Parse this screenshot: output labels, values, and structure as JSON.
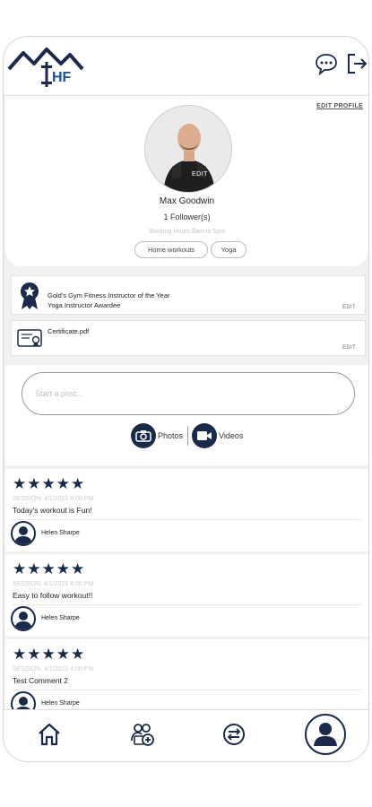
{
  "header": {
    "logo_text": "HF",
    "icons": [
      "chat-bubble-icon",
      "logout-icon"
    ]
  },
  "profile": {
    "edit_label": "EDIT PROFILE",
    "avatar_edit_label": "EDIT",
    "name": "Max Goodwin",
    "followers": "1 Follower(s)",
    "working_hours": "Working Hours 8am to 5pm",
    "tags": [
      "Home workouts",
      "Yoga"
    ]
  },
  "credentials": [
    {
      "lines": [
        "Gold's Gym Fitness Instructor of the Year",
        "Yoga Instructor Awardee"
      ],
      "edit": "EDIT",
      "icon": "award-ribbon-icon"
    },
    {
      "lines": [
        "Certificate.pdf"
      ],
      "edit": "EDIT",
      "icon": "certificate-icon"
    }
  ],
  "composer": {
    "placeholder": "Start a post...",
    "photos_label": "Photos",
    "videos_label": "Videos"
  },
  "reviews": [
    {
      "stars": "★★★★★",
      "session": "SESSION, 4/1/2021 6:00 PM",
      "text": "Today's workout is Fun!",
      "reviewer": "Helen Sharpe"
    },
    {
      "stars": "★★★★★",
      "session": "SESSION, 4/1/2021 6:00 PM",
      "text": "Easy to follow workout!!",
      "reviewer": "Helen Sharpe"
    },
    {
      "stars": "★★★★★",
      "session": "SESSION, 4/1/2021 4:00 PM",
      "text": "Test Comment 2",
      "reviewer": "Helen Sharpe"
    }
  ],
  "bottom_nav": {
    "items": [
      "home-icon",
      "add-trainer-icon",
      "transfer-icon",
      "profile-icon"
    ]
  },
  "colors": {
    "accent": "#1b2a4a",
    "logo_blue": "#1a4f9c"
  }
}
